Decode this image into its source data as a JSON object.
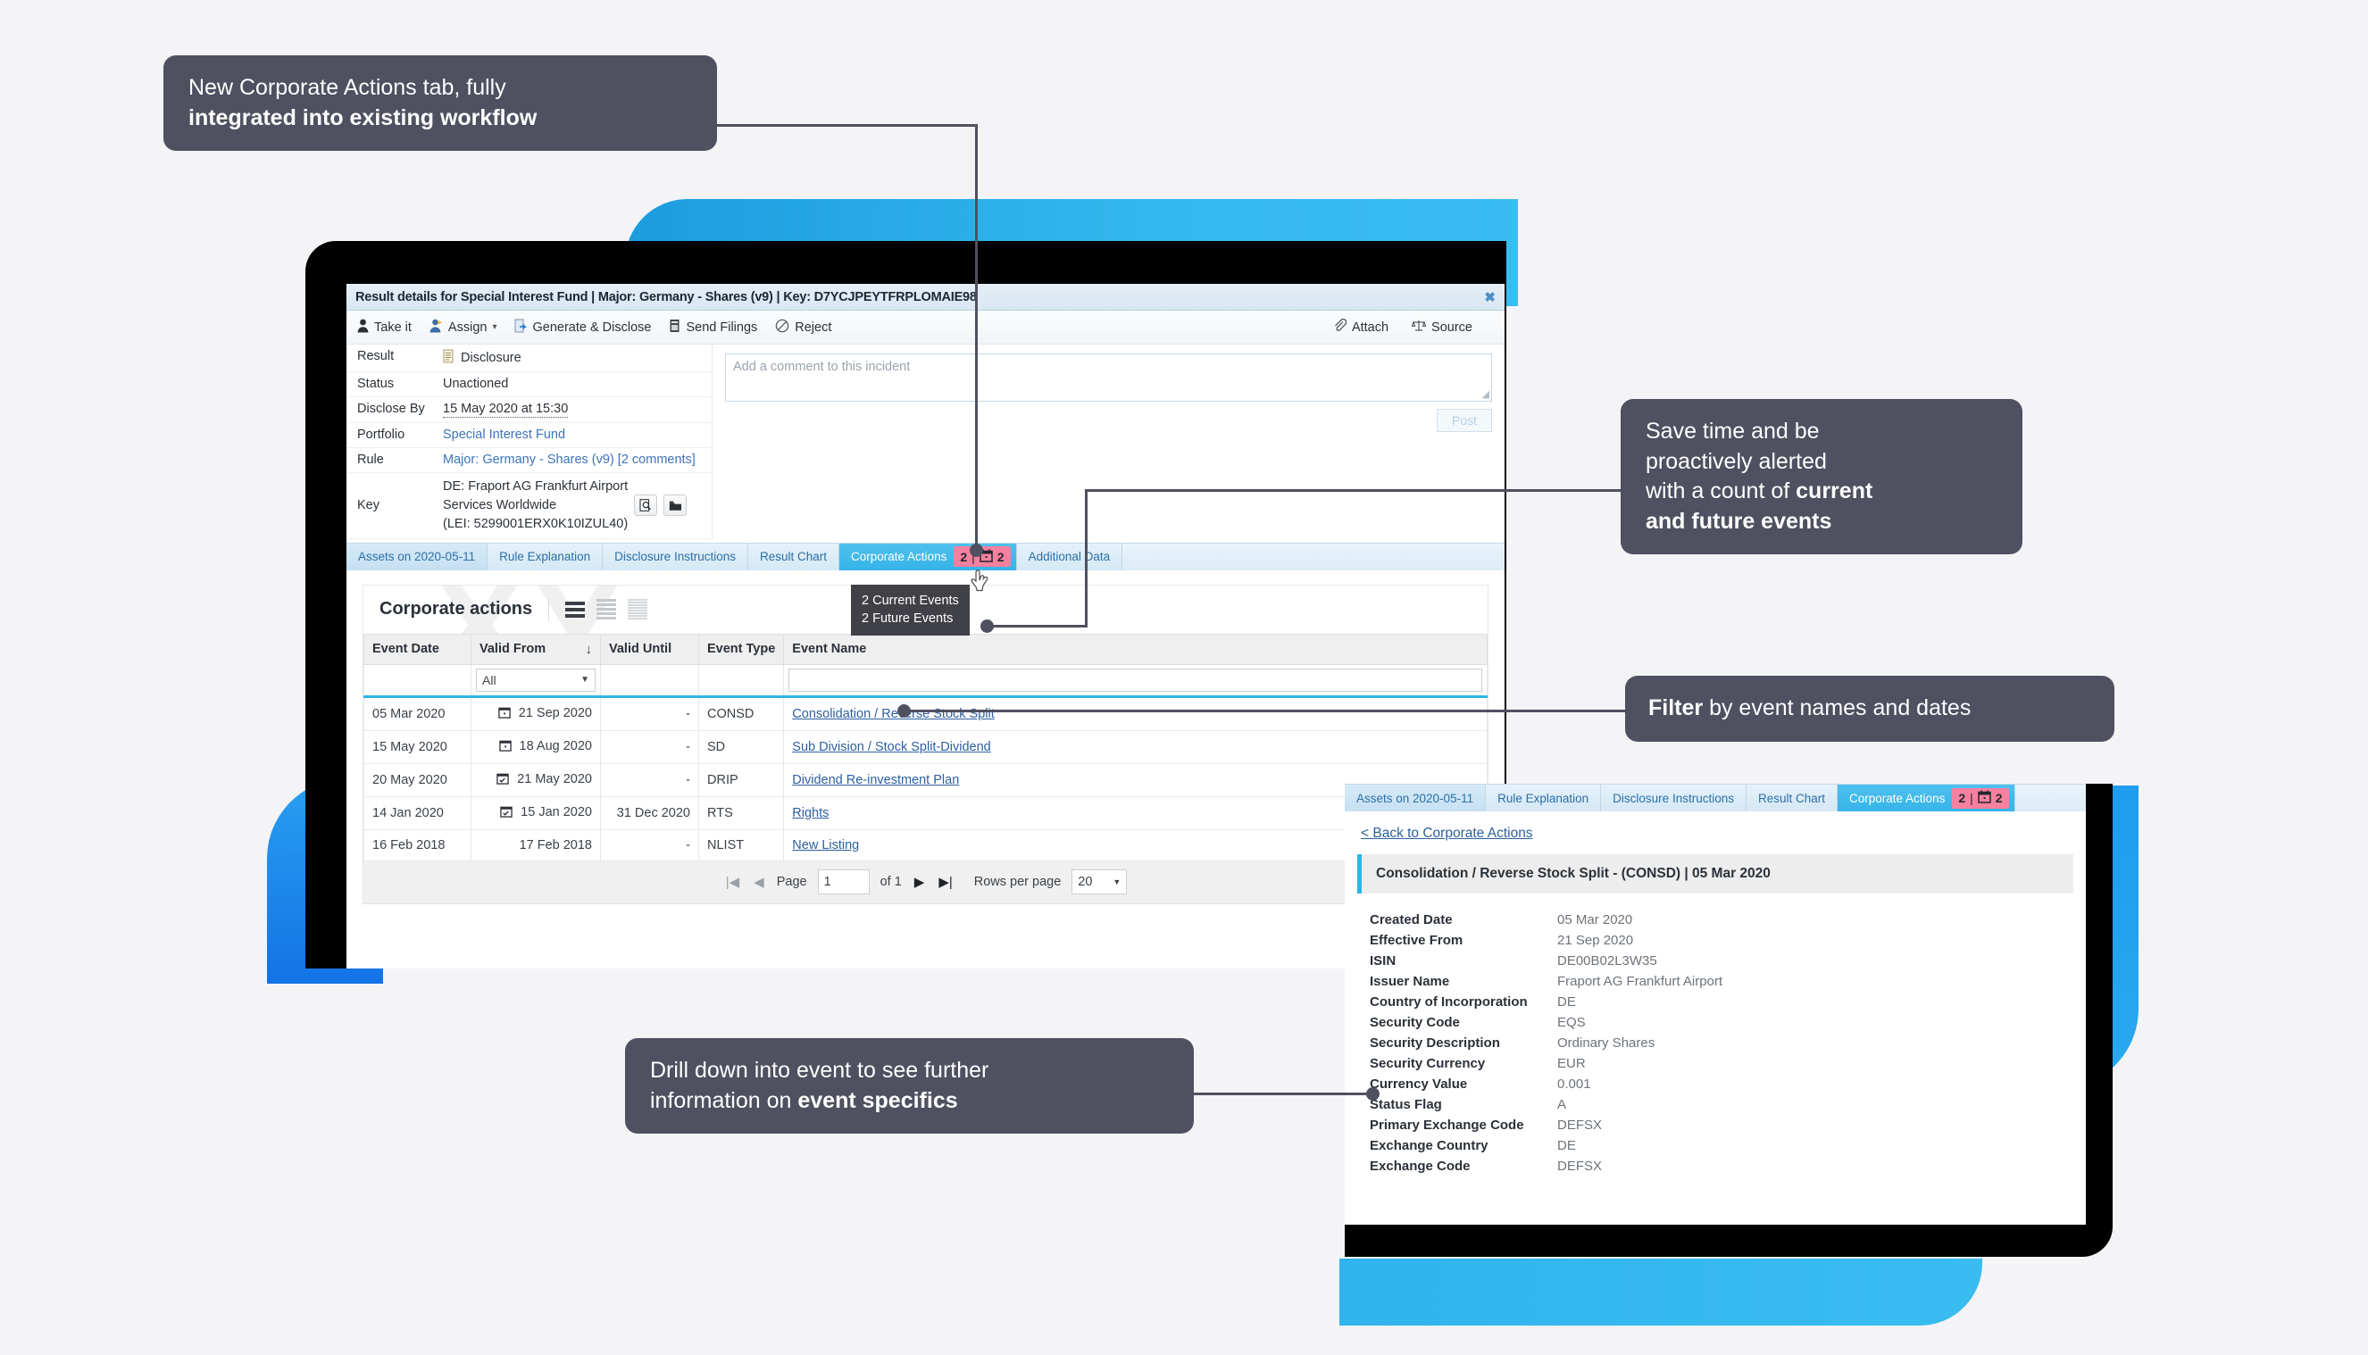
{
  "callouts": [
    {
      "id": "callout-tab",
      "plain": "New Corporate Actions tab, fully",
      "bold": "integrated into existing workflow"
    },
    {
      "id": "callout-count",
      "line1": "Save time and be",
      "line2": "proactively alerted",
      "line3_plain": "with a count of ",
      "line3_bold": "current",
      "line4_bold": "and future events"
    },
    {
      "id": "callout-filter",
      "bold": "Filter",
      "plain": " by event names and dates"
    },
    {
      "id": "callout-drill",
      "line1": "Drill down into event to see further",
      "line2_plain": "information on ",
      "line2_bold": "event specifics"
    }
  ],
  "window1": {
    "title": "Result details for Special Interest Fund | Major: Germany - Shares (v9) | Key: D7YCJPEYTFRPLOMAIE98",
    "close_label": "✖",
    "toolbar": [
      {
        "icon": "person-icon",
        "glyph": "♟",
        "label": "Take it"
      },
      {
        "icon": "assign-person-icon",
        "glyph": "♟",
        "label": "Assign",
        "caret": "▾"
      },
      {
        "icon": "document-arrow-icon",
        "glyph": "↪",
        "label": "Generate & Disclose"
      },
      {
        "icon": "send-filings-icon",
        "glyph": "▤",
        "label": "Send Filings"
      },
      {
        "icon": "reject-icon",
        "glyph": "⊘",
        "label": "Reject"
      }
    ],
    "toolbar_right": [
      {
        "icon": "paperclip-icon",
        "glyph": "📎",
        "label": "Attach"
      },
      {
        "icon": "scales-icon",
        "glyph": "⚖",
        "label": "Source"
      }
    ],
    "details": [
      {
        "label": "Result",
        "value": "Disclosure",
        "icon": "document-icon",
        "glyph": "📄",
        "style": "plain"
      },
      {
        "label": "Status",
        "value": "Unactioned",
        "style": "plain"
      },
      {
        "label": "Disclose By",
        "value": "15 May 2020 at 15:30",
        "style": "dotted"
      },
      {
        "label": "Portfolio",
        "value": "Special Interest Fund",
        "style": "link"
      },
      {
        "label": "Rule",
        "value": "Major: Germany - Shares (v9) [2 comments]",
        "style": "link"
      }
    ],
    "key_row": {
      "label": "Key",
      "line1": "DE: Fraport AG Frankfurt Airport",
      "line2": "Services Worldwide",
      "line3": "(LEI: 5299001ERX0K10IZUL40)",
      "btn1_icon": "document-search-icon",
      "btn1_glyph": "🔍",
      "btn2_icon": "folder-icon",
      "btn2_glyph": "📁"
    },
    "comment": {
      "placeholder": "Add a comment to this incident",
      "post_label": "Post"
    },
    "tabs": [
      {
        "label": "Assets on 2020-05-11",
        "active": false
      },
      {
        "label": "Rule Explanation",
        "active": false
      },
      {
        "label": "Disclosure Instructions",
        "active": false
      },
      {
        "label": "Result Chart",
        "active": false
      },
      {
        "label": "Corporate Actions",
        "active": true,
        "badge_current": "2",
        "badge_sep": "|",
        "badge_icon": "calendar-icon",
        "badge_future": "2"
      },
      {
        "label": "Additional Data",
        "active": false
      }
    ],
    "tooltip": {
      "line1": "2 Current Events",
      "line2": "2 Future Events"
    },
    "corporate_actions": {
      "title": "Corporate actions",
      "watermark": "XY",
      "density_icons": [
        "rows-large-icon",
        "rows-medium-icon",
        "rows-small-icon"
      ],
      "columns": [
        "Event Date",
        "Valid From",
        "Valid Until",
        "Event Type",
        "Event Name"
      ],
      "sort_column": "Valid From",
      "sort_arrow": "↓",
      "filters": {
        "valid_from": "All",
        "valid_from_caret": "▼"
      },
      "rows": [
        {
          "event_date": "05 Mar 2020",
          "valid_from": "21 Sep 2020",
          "cal_icon": "calendar-icon",
          "valid_until": "-",
          "event_type": "CONSD",
          "event_name": "Consolidation / Reverse Stock Split"
        },
        {
          "event_date": "15 May 2020",
          "valid_from": "18 Aug 2020",
          "cal_icon": "calendar-icon",
          "valid_until": "-",
          "event_type": "SD",
          "event_name": "Sub Division / Stock Split-Dividend"
        },
        {
          "event_date": "20 May 2020",
          "valid_from": "21 May 2020",
          "cal_icon": "calendar-check-icon",
          "valid_until": "-",
          "event_type": "DRIP",
          "event_name": "Dividend Re-investment Plan"
        },
        {
          "event_date": "14 Jan 2020",
          "valid_from": "15 Jan 2020",
          "cal_icon": "calendar-check-icon",
          "valid_until": "31 Dec 2020",
          "event_type": "RTS",
          "event_name": "Rights"
        },
        {
          "event_date": "16 Feb 2018",
          "valid_from": "17 Feb 2018",
          "cal_icon": "",
          "valid_until": "-",
          "event_type": "NLIST",
          "event_name": "New Listing"
        }
      ],
      "pager": {
        "first": "|◀",
        "prev": "◀",
        "page_label": "Page",
        "page_value": "1",
        "of_label": "of 1",
        "next": "▶",
        "last": "▶|",
        "rows_label": "Rows per page",
        "rows_value": "20",
        "rows_caret": "▼"
      }
    }
  },
  "window2": {
    "tabs": [
      {
        "label": "Assets on 2020-05-11",
        "active": false
      },
      {
        "label": "Rule Explanation",
        "active": false
      },
      {
        "label": "Disclosure Instructions",
        "active": false
      },
      {
        "label": "Result Chart",
        "active": false
      },
      {
        "label": "Corporate Actions",
        "active": true,
        "badge_current": "2",
        "badge_sep": "|",
        "badge_icon": "calendar-icon",
        "badge_future": "2"
      }
    ],
    "back_link": "< Back to Corporate Actions",
    "banner": "Consolidation / Reverse Stock Split - (CONSD) | 05 Mar 2020",
    "fields": [
      {
        "key": "Created Date",
        "value": "05 Mar 2020"
      },
      {
        "key": "Effective From",
        "value": "21 Sep 2020"
      },
      {
        "key": "ISIN",
        "value": "DE00B02L3W35"
      },
      {
        "key": "Issuer Name",
        "value": "Fraport AG Frankfurt Airport"
      },
      {
        "key": "Country of Incorporation",
        "value": "DE"
      },
      {
        "key": "Security Code",
        "value": "EQS"
      },
      {
        "key": "Security Description",
        "value": "Ordinary Shares"
      },
      {
        "key": "Security Currency",
        "value": "EUR"
      },
      {
        "key": "Currency Value",
        "value": "0.001"
      },
      {
        "key": "Status Flag",
        "value": "A"
      },
      {
        "key": "Primary Exchange Code",
        "value": "DEFSX"
      },
      {
        "key": "Exchange Country",
        "value": "DE"
      },
      {
        "key": "Exchange Code",
        "value": "DEFSX"
      }
    ]
  },
  "colors": {
    "background": "#f4f4f7",
    "callout_bg": "#4f5060",
    "accent_blue": "#35b4e8",
    "badge_pink": "#f6809f",
    "device_black": "#000000",
    "blue_shape": "#2aa9f1"
  }
}
